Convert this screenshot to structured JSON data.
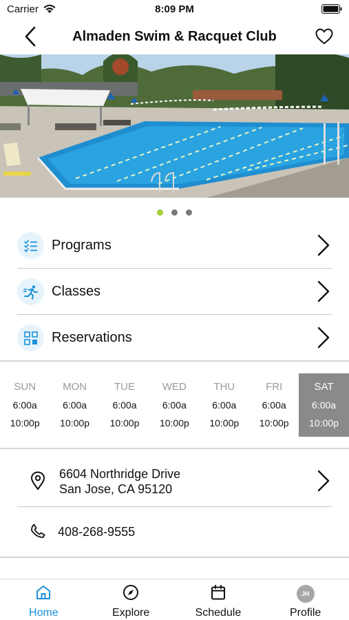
{
  "status_bar": {
    "carrier": "Carrier",
    "time": "8:09 PM"
  },
  "header": {
    "title": "Almaden Swim & Racquet Club",
    "back_icon": "chevron-left-icon",
    "favorite_icon": "heart-icon"
  },
  "carousel": {
    "image_subject": "outdoor swimming pool",
    "page_count": 3,
    "active_index": 0
  },
  "menu": {
    "items": [
      {
        "label": "Programs",
        "icon": "checklist-icon"
      },
      {
        "label": "Classes",
        "icon": "running-figure-icon"
      },
      {
        "label": "Reservations",
        "icon": "grid-icon"
      }
    ]
  },
  "hours": {
    "days": [
      {
        "day": "SUN",
        "open": "6:00a",
        "close": "10:00p"
      },
      {
        "day": "MON",
        "open": "6:00a",
        "close": "10:00p"
      },
      {
        "day": "TUE",
        "open": "6:00a",
        "close": "10:00p"
      },
      {
        "day": "WED",
        "open": "6:00a",
        "close": "10:00p"
      },
      {
        "day": "THU",
        "open": "6:00a",
        "close": "10:00p"
      },
      {
        "day": "FRI",
        "open": "6:00a",
        "close": "10:00p"
      },
      {
        "day": "SAT",
        "open": "6:00a",
        "close": "10:00p"
      }
    ],
    "highlighted_day": "SAT"
  },
  "contact": {
    "address_line1": "6604 Northridge Drive",
    "address_line2": "San Jose, CA 95120",
    "phone": "408-268-9555"
  },
  "tabbar": {
    "tabs": [
      {
        "label": "Home",
        "icon": "home-icon",
        "active": true
      },
      {
        "label": "Explore",
        "icon": "compass-icon",
        "active": false
      },
      {
        "label": "Schedule",
        "icon": "calendar-icon",
        "active": false
      },
      {
        "label": "Profile",
        "icon": "avatar",
        "active": false
      }
    ],
    "profile_initials": "JH"
  },
  "colors": {
    "accent": "#1a90d8",
    "dot_active": "#9fcf3a",
    "today_bg": "#8a8a8a",
    "icon_bg": "#e6f3fb"
  }
}
